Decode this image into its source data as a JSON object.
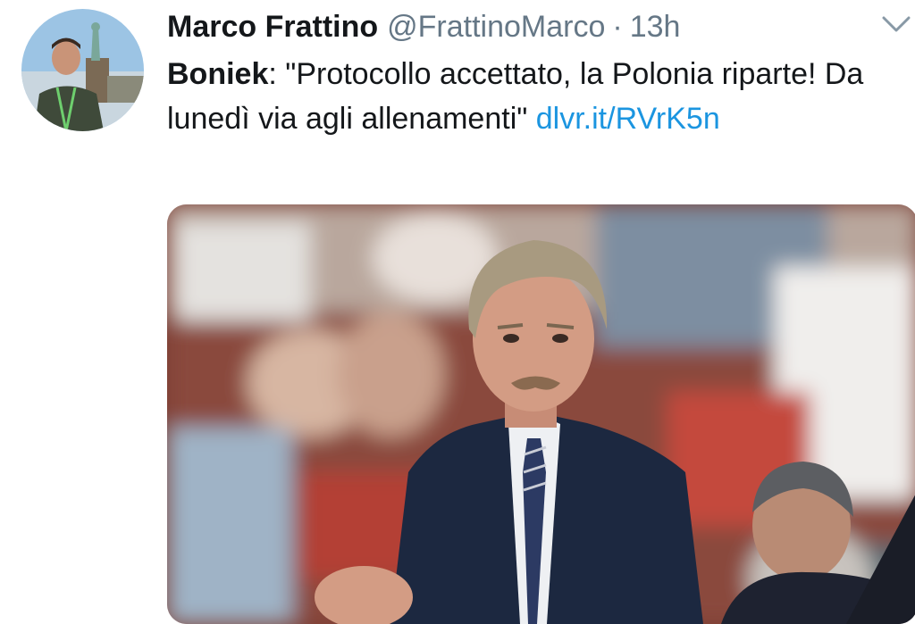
{
  "tweet": {
    "author_name": "Marco Frattino",
    "handle": "@FrattinoMarco",
    "separator": "·",
    "time": "13h",
    "text_bold": "Boniek",
    "text_body": ": \"Protocollo accettato, la Polonia riparte! Da lunedì via agli allenamenti\" ",
    "link_text": "dlvr.it/RVrK5n"
  },
  "icons": {
    "menu": "chevron-down-icon"
  },
  "colors": {
    "link": "#1b95e0",
    "name": "#14171a",
    "meta": "#657786"
  }
}
